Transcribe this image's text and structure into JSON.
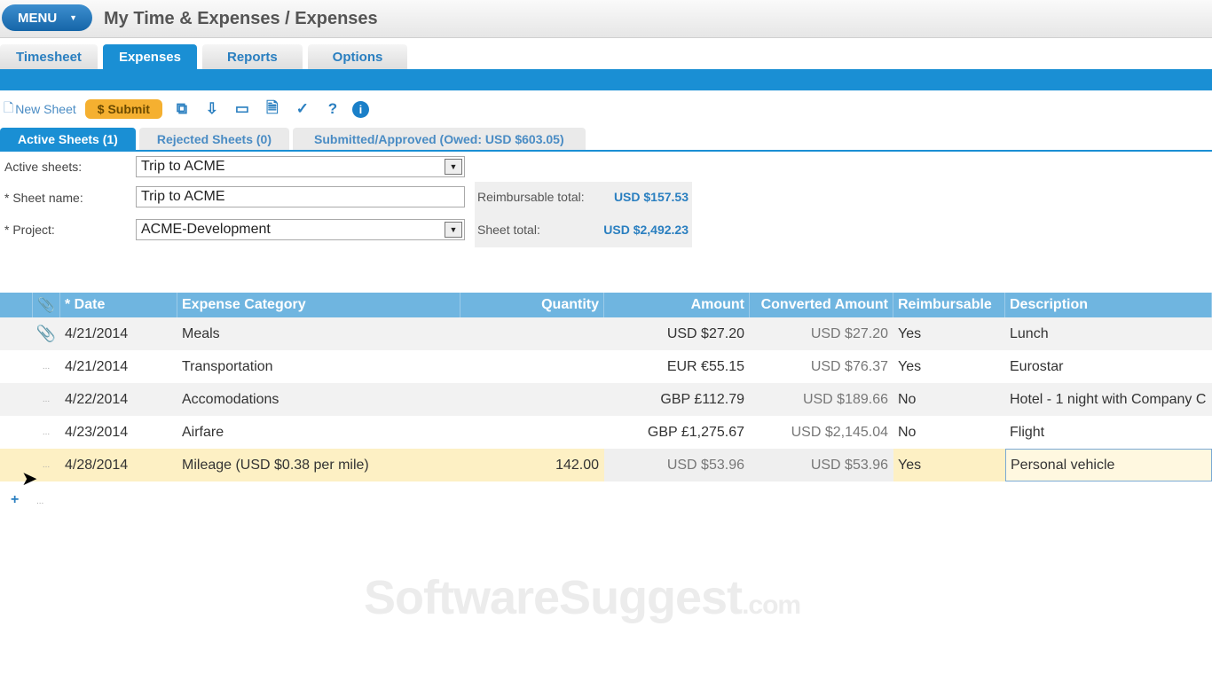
{
  "header": {
    "menu_label": "MENU",
    "title": "My Time & Expenses / Expenses"
  },
  "tabs": [
    {
      "label": "Timesheet"
    },
    {
      "label": "Expenses"
    },
    {
      "label": "Reports"
    },
    {
      "label": "Options"
    }
  ],
  "toolbar": {
    "new_sheet": "New Sheet",
    "submit": "Submit",
    "help": "?",
    "info": "i"
  },
  "subtabs": [
    {
      "label": "Active Sheets (1)"
    },
    {
      "label": "Rejected Sheets (0)"
    },
    {
      "label": "Submitted/Approved (Owed: USD $603.05)"
    }
  ],
  "form": {
    "active_sheets_label": "Active sheets:",
    "active_sheets_value": "Trip to ACME",
    "sheet_name_label": "* Sheet name:",
    "sheet_name_value": "Trip to ACME",
    "project_label": "* Project:",
    "project_value": "ACME-Development"
  },
  "summary": {
    "reimbursable_label": "Reimbursable total:",
    "reimbursable_value": "USD $157.53",
    "sheet_total_label": "Sheet total:",
    "sheet_total_value": "USD $2,492.23"
  },
  "table": {
    "headers": {
      "date": "* Date",
      "category": "Expense Category",
      "quantity": "Quantity",
      "amount": "Amount",
      "converted": "Converted Amount",
      "reimbursable": "Reimbursable",
      "description": "Description"
    },
    "rows": [
      {
        "date": "4/21/2014",
        "category": "Meals",
        "quantity": "",
        "amount": "USD $27.20",
        "converted": "USD $27.20",
        "reimbursable": "Yes",
        "description": "Lunch"
      },
      {
        "date": "4/21/2014",
        "category": "Transportation",
        "quantity": "",
        "amount": "EUR €55.15",
        "converted": "USD $76.37",
        "reimbursable": "Yes",
        "description": "Eurostar"
      },
      {
        "date": "4/22/2014",
        "category": "Accomodations",
        "quantity": "",
        "amount": "GBP £112.79",
        "converted": "USD $189.66",
        "reimbursable": "No",
        "description": "Hotel - 1 night with Company C"
      },
      {
        "date": "4/23/2014",
        "category": "Airfare",
        "quantity": "",
        "amount": "GBP £1,275.67",
        "converted": "USD $2,145.04",
        "reimbursable": "No",
        "description": "Flight"
      },
      {
        "date": "4/28/2014",
        "category": "Mileage (USD $0.38 per mile)",
        "quantity": "142.00",
        "amount": "USD $53.96",
        "converted": "USD $53.96",
        "reimbursable": "Yes",
        "description": "Personal vehicle"
      }
    ],
    "row_dots": "...",
    "add_row": "+"
  },
  "watermark": {
    "main": "SoftwareSuggest",
    "suffix": ".com"
  }
}
